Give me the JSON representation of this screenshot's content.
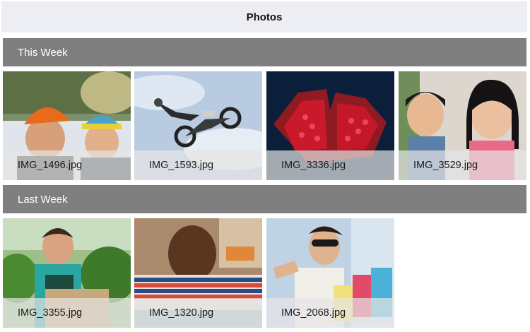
{
  "app": {
    "title": "Photos"
  },
  "sections": [
    {
      "label": "This Week",
      "photos": [
        {
          "filename": "IMG_1496.jpg",
          "subject": "couple in winter hats"
        },
        {
          "filename": "IMG_1593.jpg",
          "subject": "motocross jump"
        },
        {
          "filename": "IMG_3336.jpg",
          "subject": "pomegranate"
        },
        {
          "filename": "IMG_3529.jpg",
          "subject": "two children"
        }
      ]
    },
    {
      "label": "Last Week",
      "photos": [
        {
          "filename": "IMG_3355.jpg",
          "subject": "farmer with vegetables"
        },
        {
          "filename": "IMG_1320.jpg",
          "subject": "smiling boy"
        },
        {
          "filename": "IMG_2068.jpg",
          "subject": "woman with shopping bags"
        }
      ]
    }
  ]
}
